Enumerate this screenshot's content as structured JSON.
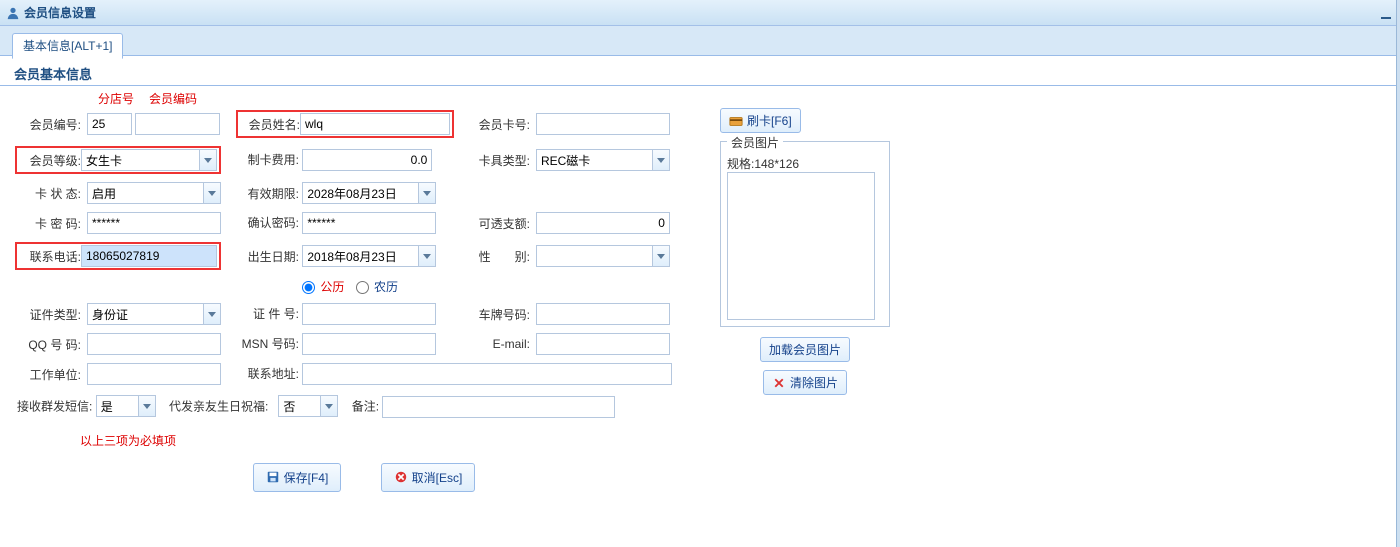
{
  "window": {
    "title": "会员信息设置"
  },
  "tab": {
    "label": "基本信息[ALT+1]"
  },
  "section": {
    "title": "会员基本信息"
  },
  "hints": {
    "branch": "分店号",
    "code": "会员编码"
  },
  "labels": {
    "memberNo": "会员编号:",
    "memberName": "会员姓名:",
    "memberCardNo": "会员卡号:",
    "memberLevel": "会员等级:",
    "cardFee": "制卡费用:",
    "cardType": "卡具类型:",
    "cardStatus": "卡 状 态:",
    "validDate": "有效期限:",
    "cardPwd": "卡 密 码:",
    "confirmPwd": "确认密码:",
    "overdraft": "可透支额:",
    "phone": "联系电话:",
    "birthday": "出生日期:",
    "gender": "性　　别:",
    "idType": "证件类型:",
    "idNo": "证 件 号:",
    "plate": "车牌号码:",
    "qq": "QQ 号 码:",
    "msn": "MSN 号码:",
    "email": "E-mail:",
    "company": "工作单位:",
    "address": "联系地址:",
    "receiveSms": "接收群发短信:",
    "relativeBless": "代发亲友生日祝福:",
    "remark": "备注:"
  },
  "values": {
    "branchNo": "25",
    "memberCode": "",
    "memberName": "wlq",
    "memberCardNo": "",
    "memberLevel": "女生卡",
    "cardFee": "0.0",
    "cardType": "REC磁卡",
    "cardStatus": "启用",
    "validDate": "2028年08月23日",
    "cardPwd": "******",
    "confirmPwd": "******",
    "overdraft": "0",
    "phone": "18065027819",
    "birthday": "2018年08月23日",
    "gender": "",
    "idType": "身份证",
    "idNo": "",
    "plate": "",
    "qq": "",
    "msn": "",
    "email": "",
    "company": "",
    "address": "",
    "receiveSms": "是",
    "relativeBless": "否",
    "remark": ""
  },
  "calendar": {
    "solar": "公历",
    "lunar": "农历"
  },
  "rightPanel": {
    "swipe": "刷卡[F6]",
    "imageGroup": "会员图片",
    "spec": "规格:148*126",
    "load": "加载会员图片",
    "clear": "清除图片"
  },
  "noteRequired": "以上三项为必填项",
  "actions": {
    "save": "保存[F4]",
    "cancel": "取消[Esc]"
  }
}
